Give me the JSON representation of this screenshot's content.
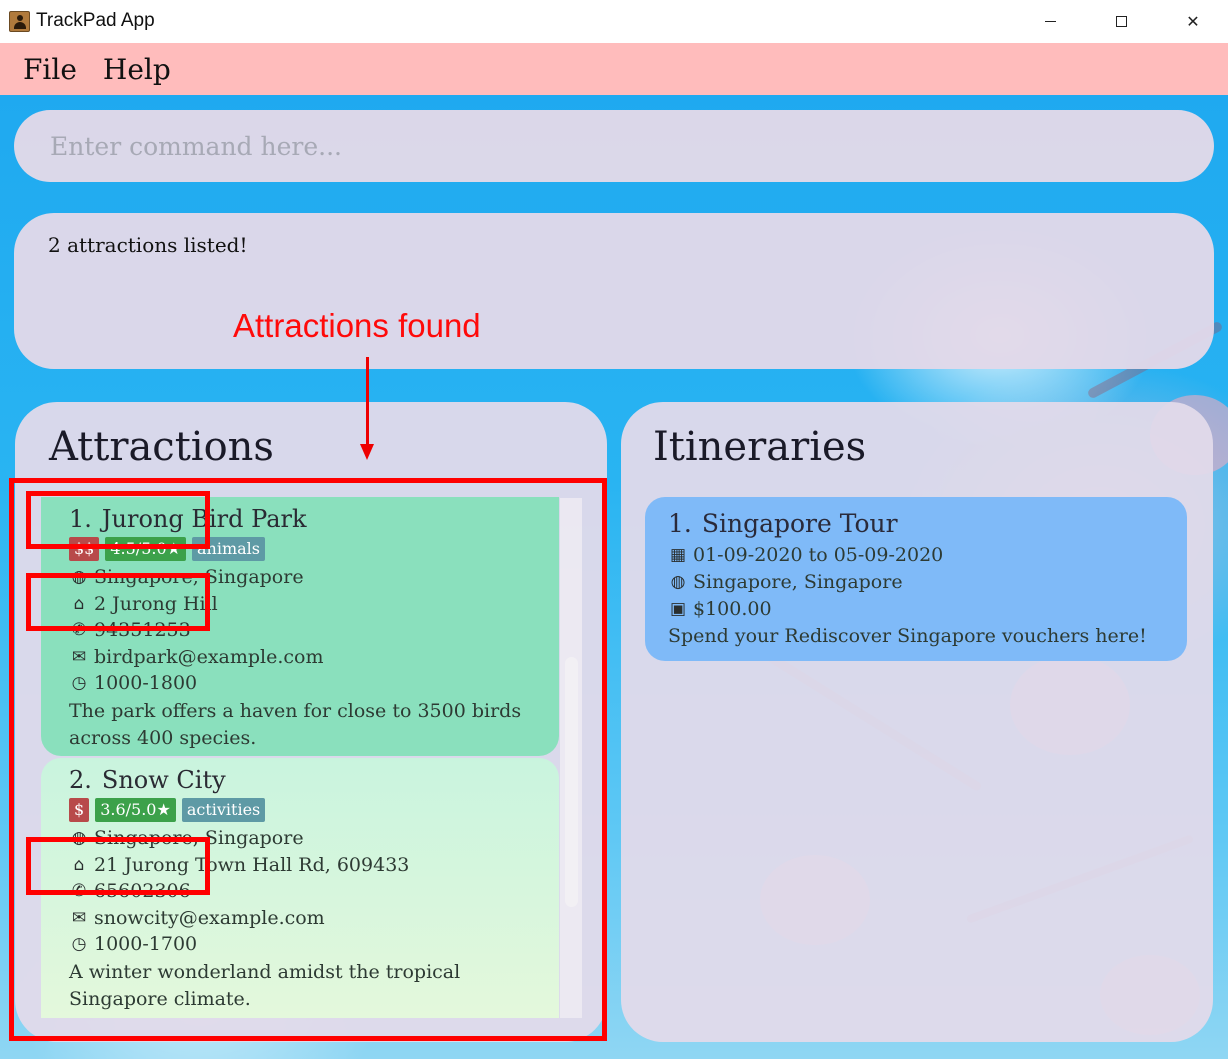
{
  "window": {
    "title": "TrackPad App",
    "controls": {
      "minimize": "",
      "maximize": "",
      "close": "✕"
    }
  },
  "menu": {
    "items": [
      "File",
      "Help"
    ]
  },
  "command": {
    "placeholder": "Enter command here...",
    "value": ""
  },
  "result": {
    "text": "2 attractions listed!"
  },
  "annotation": {
    "label": "Attractions found",
    "color": "#ff0000"
  },
  "attractions": {
    "title": "Attractions",
    "items": [
      {
        "index": "1.",
        "name": "Jurong Bird Park",
        "price": "$$",
        "rating": "4.5/5.0★",
        "tag": "animals",
        "location": "Singapore, Singapore",
        "address": "2 Jurong Hill",
        "phone": "94351253",
        "email": "birdpark@example.com",
        "hours": "1000-1800",
        "description": "The park offers a haven for close to 3500 birds across 400 species.",
        "color": "#8ae0bd"
      },
      {
        "index": "2.",
        "name": "Snow City",
        "price": "$",
        "rating": "3.6/5.0★",
        "tag": "activities",
        "location": "Singapore, Singapore",
        "address": "21 Jurong Town Hall Rd, 609433",
        "phone": "65602306",
        "email": "snowcity@example.com",
        "hours": "1000-1700",
        "description": "A winter wonderland amidst the tropical Singapore climate.",
        "color": "#d4f6dd"
      }
    ]
  },
  "itineraries": {
    "title": "Itineraries",
    "items": [
      {
        "index": "1.",
        "name": "Singapore Tour",
        "dates": "01-09-2020 to 05-09-2020",
        "location": "Singapore, Singapore",
        "budget": "$100.00",
        "description": "Spend your Rediscover Singapore vouchers here!",
        "color": "#7fbaf8"
      }
    ]
  },
  "icons": {
    "location": "globe-icon",
    "address": "home-icon",
    "phone": "phone-icon",
    "email": "email-icon",
    "hours": "clock-icon",
    "dates": "calendar-icon",
    "budget": "money-icon"
  }
}
